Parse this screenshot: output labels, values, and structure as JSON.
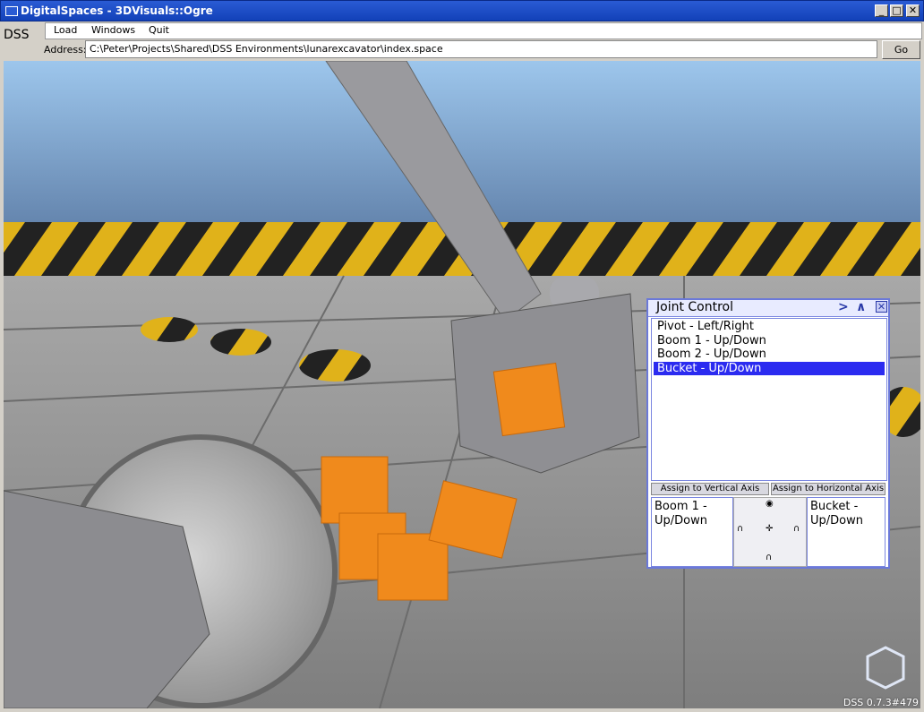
{
  "window": {
    "title": "DigitalSpaces - 3DVisuals::Ogre",
    "minimize_label": "_",
    "maximize_label": "□",
    "close_label": "✕"
  },
  "app": {
    "dss_label": "DSS"
  },
  "menu": {
    "items": [
      "Load",
      "Windows",
      "Quit"
    ]
  },
  "address": {
    "label": "Address:",
    "value": "C:\\Peter\\Projects\\Shared\\DSS Environments\\lunarexcavator\\index.space",
    "go_label": "Go"
  },
  "joint_control": {
    "title": "Joint Control",
    "forward_label": ">",
    "up_label": "∧",
    "close_label": "✕",
    "joints": [
      {
        "label": "Pivot - Left/Right",
        "selected": false
      },
      {
        "label": "Boom 1 - Up/Down",
        "selected": false
      },
      {
        "label": "Boom 2 - Up/Down",
        "selected": false
      },
      {
        "label": "Bucket - Up/Down",
        "selected": true
      }
    ],
    "assign_vertical_label": "Assign to Vertical Axis",
    "assign_horizontal_label": "Assign to Horizontal Axis",
    "vertical_axis_value": "Boom 1 - Up/Down",
    "horizontal_axis_value": "Bucket - Up/Down"
  },
  "status": {
    "version": "DSS 0.7.3#479"
  },
  "colors": {
    "titlebar": "#1f4fc9",
    "selection": "#2b2bf0",
    "panel_border": "#6b79d8",
    "crate": "#f08a1c"
  }
}
